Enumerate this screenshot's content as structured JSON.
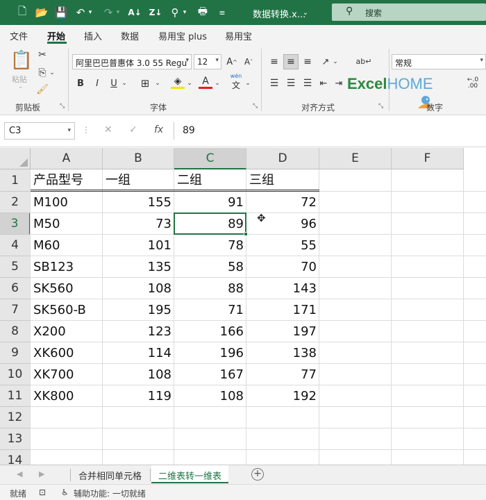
{
  "titlebar": {
    "doc_title": "数据转换.x...",
    "search_label": "搜索",
    "bg_color": "#217346"
  },
  "ribbon": {
    "tabs": [
      "文件",
      "开始",
      "插入",
      "数据",
      "易用宝 plus",
      "易用宝"
    ],
    "active_tab": "开始",
    "clipboard": {
      "paste_label": "粘贴",
      "group_label": "剪贴板"
    },
    "font": {
      "font_name": "阿里巴巴普惠体 3.0 55 Regu",
      "font_size": "12",
      "group_label": "字体",
      "wen_label": "wén"
    },
    "alignment": {
      "group_label": "对齐方式"
    },
    "number": {
      "format": "常规",
      "group_label": "数字"
    },
    "logo": {
      "excel": "Excel",
      "home": "HOME"
    }
  },
  "formula_bar": {
    "name_box": "C3",
    "fx_label": "fx",
    "value": "89"
  },
  "grid": {
    "columns": [
      "A",
      "B",
      "C",
      "D",
      "E",
      "F"
    ],
    "selected_column": "C",
    "rows": [
      "1",
      "2",
      "3",
      "4",
      "5",
      "6",
      "7",
      "8",
      "9",
      "10",
      "11",
      "12",
      "13",
      "14"
    ],
    "selected_row": "3",
    "header": [
      "产品型号",
      "一组",
      "二组",
      "三组"
    ],
    "data": [
      [
        "M100",
        "155",
        "91",
        "72"
      ],
      [
        "M50",
        "73",
        "89",
        "96"
      ],
      [
        "M60",
        "101",
        "78",
        "55"
      ],
      [
        "SB123",
        "135",
        "58",
        "70"
      ],
      [
        "SK560",
        "108",
        "88",
        "143"
      ],
      [
        "SK560-B",
        "195",
        "71",
        "171"
      ],
      [
        "X200",
        "123",
        "166",
        "197"
      ],
      [
        "XK600",
        "114",
        "196",
        "138"
      ],
      [
        "XK700",
        "108",
        "167",
        "77"
      ],
      [
        "XK800",
        "119",
        "108",
        "192"
      ]
    ],
    "accent_color": "#217346"
  },
  "sheets": {
    "tabs": [
      "合并相同单元格",
      "二维表转一维表"
    ],
    "active": "二维表转一维表",
    "add_label": "+"
  },
  "status": {
    "ready": "就绪",
    "accessibility": "辅助功能: 一切就绪"
  }
}
